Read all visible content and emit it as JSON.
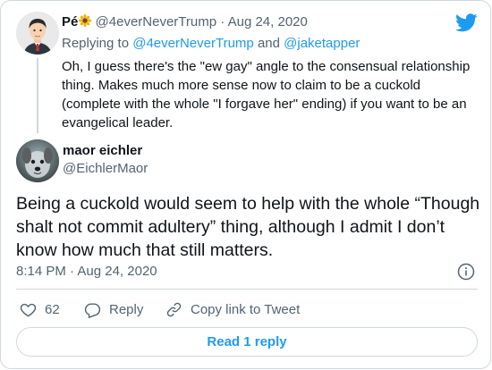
{
  "parent_tweet": {
    "display_name": "Pé",
    "name_emoji_icon": "sunflower-icon",
    "handle": "@4everNeverTrump",
    "separator": "·",
    "date": "Aug 24, 2020",
    "replying_prefix": "Replying to",
    "reply_targets": [
      "@4everNeverTrump",
      "@jaketapper"
    ],
    "reply_joiner": "and",
    "text": "Oh, I guess there's the \"ew gay\" angle to the consensual relationship thing. Makes much more sense now to claim to be a cuckold (complete with the whole \"I forgave her\" ending) if you want to be an evangelical leader."
  },
  "main_tweet": {
    "display_name": "maor eichler",
    "handle": "@EichlerMaor",
    "text": "Being a cuckold would seem to help with the whole “Though shalt not commit adultery” thing, although I admit I don’t know how much that still matters.",
    "time": "8:14 PM",
    "separator": "·",
    "date": "Aug 24, 2020"
  },
  "actions": {
    "like_count": "62",
    "reply_label": "Reply",
    "copy_link_label": "Copy link to Tweet"
  },
  "read_replies_label": "Read 1 reply",
  "colors": {
    "accent": "#1d9bf0",
    "text": "#0f1419",
    "muted": "#536471",
    "border": "#cfd9de"
  }
}
